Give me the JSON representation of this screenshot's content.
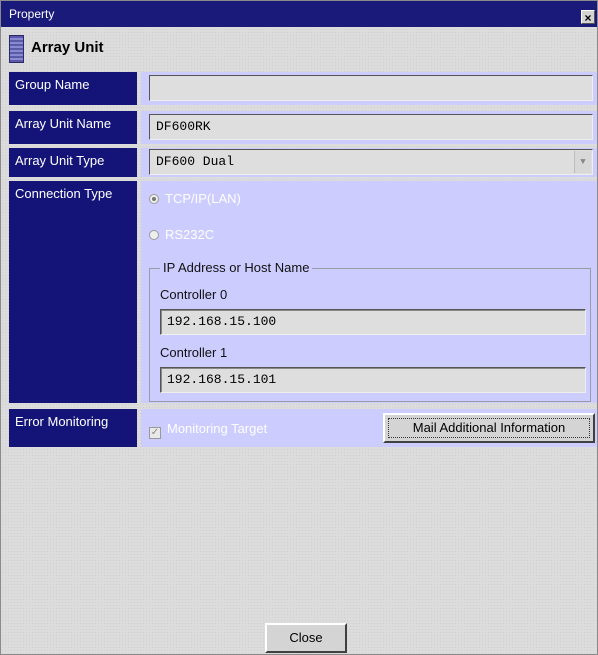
{
  "window": {
    "title": "Property"
  },
  "header": {
    "title": "Array Unit"
  },
  "labels": {
    "group_name": "Group Name",
    "array_unit_name": "Array Unit Name",
    "array_unit_type": "Array Unit Type",
    "connection_type": "Connection Type",
    "error_monitoring": "Error Monitoring"
  },
  "fields": {
    "group_name": "",
    "array_unit_name": "DF600RK",
    "array_unit_type": "DF600 Dual"
  },
  "connection": {
    "option_lan": "TCP/IP(LAN)",
    "option_rs232c": "RS232C",
    "selected": "TCP/IP(LAN)",
    "group_label": "IP Address or Host Name",
    "controller0_label": "Controller 0",
    "controller0_value": "192.168.15.100",
    "controller1_label": "Controller 1",
    "controller1_value": "192.168.15.101"
  },
  "error_monitoring": {
    "checkbox_label": "Monitoring Target",
    "checked": true,
    "mail_button": "Mail Additional Information"
  },
  "footer": {
    "close_button": "Close"
  },
  "colors": {
    "titlebar": "#1a1a7a",
    "label_bg": "#141478",
    "field_area_bg": "#ccccff"
  }
}
